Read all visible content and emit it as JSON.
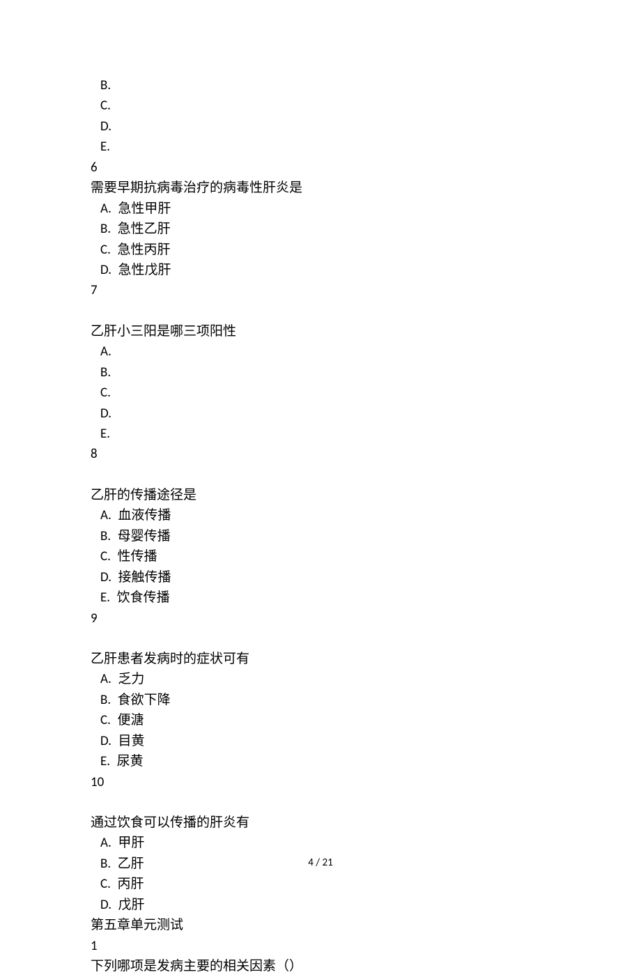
{
  "q5_tail": {
    "opts": [
      {
        "letter": "B.",
        "text": ""
      },
      {
        "letter": "C.",
        "text": ""
      },
      {
        "letter": "D.",
        "text": ""
      },
      {
        "letter": "E.",
        "text": ""
      }
    ]
  },
  "q6": {
    "num": "6",
    "stem": "需要早期抗病毒治疗的病毒性肝炎是",
    "opts": [
      {
        "letter": "A.",
        "text": "急性甲肝"
      },
      {
        "letter": "B.",
        "text": "急性乙肝"
      },
      {
        "letter": "C.",
        "text": "急性丙肝"
      },
      {
        "letter": "D.",
        "text": "急性戊肝"
      }
    ]
  },
  "q7": {
    "num": "7",
    "stem": "乙肝小三阳是哪三项阳性",
    "opts": [
      {
        "letter": "A.",
        "text": ""
      },
      {
        "letter": "B.",
        "text": ""
      },
      {
        "letter": "C.",
        "text": ""
      },
      {
        "letter": "D.",
        "text": ""
      },
      {
        "letter": "E.",
        "text": ""
      }
    ]
  },
  "q8": {
    "num": "8",
    "stem": "乙肝的传播途径是",
    "opts": [
      {
        "letter": "A.",
        "text": "血液传播"
      },
      {
        "letter": "B.",
        "text": "母婴传播"
      },
      {
        "letter": "C.",
        "text": "性传播"
      },
      {
        "letter": "D.",
        "text": "接触传播"
      },
      {
        "letter": "E.",
        "text": "饮食传播"
      }
    ]
  },
  "q9": {
    "num": "9",
    "stem": "乙肝患者发病时的症状可有",
    "opts": [
      {
        "letter": "A.",
        "text": "乏力"
      },
      {
        "letter": "B.",
        "text": "食欲下降"
      },
      {
        "letter": "C.",
        "text": "便溏"
      },
      {
        "letter": "D.",
        "text": "目黄"
      },
      {
        "letter": "E.",
        "text": "尿黄"
      }
    ]
  },
  "q10": {
    "num": "10",
    "stem": "通过饮食可以传播的肝炎有",
    "opts": [
      {
        "letter": "A.",
        "text": "甲肝"
      },
      {
        "letter": "B.",
        "text": "乙肝"
      },
      {
        "letter": "C.",
        "text": "丙肝"
      },
      {
        "letter": "D.",
        "text": "戊肝"
      }
    ]
  },
  "chapter5": {
    "title": "第五章单元测试",
    "q1": {
      "num": "1",
      "stem": "下列哪项是发病主要的相关因素（）"
    }
  },
  "footer": "4  /  21"
}
